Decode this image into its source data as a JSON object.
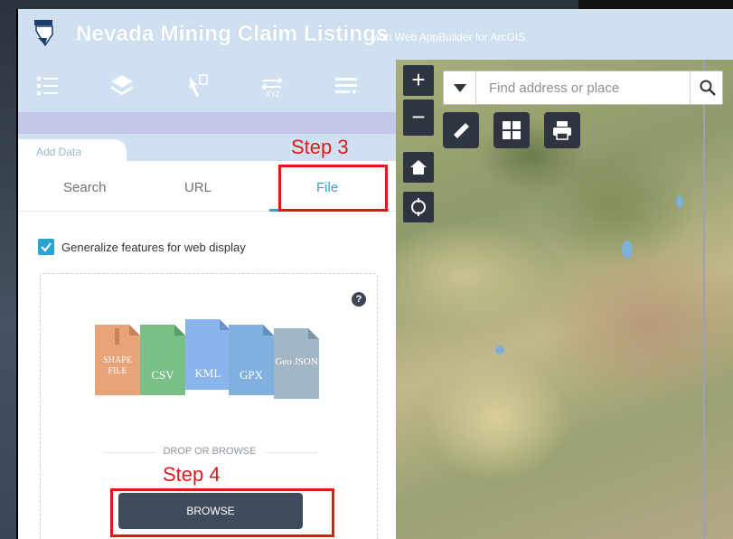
{
  "header": {
    "title": "Nevada Mining Claim Listings",
    "subtitle": "with Web AppBuilder for ArcGIS"
  },
  "toolbar": {
    "icons": [
      "legend-icon",
      "layers-icon",
      "measure-coordinates-icon",
      "xyz-coordinate-icon",
      "list-icon"
    ]
  },
  "panel": {
    "tab_label": "Add Data",
    "subtabs": [
      "Search",
      "URL",
      "File"
    ],
    "active_subtab": "File",
    "generalize_label": "Generalize features for web display",
    "generalize_checked": true,
    "file_types": [
      {
        "label": "SHAPE FILE",
        "color": "#e8a478"
      },
      {
        "label": "CSV",
        "color": "#7bbf88"
      },
      {
        "label": "KML",
        "color": "#8ab4ec"
      },
      {
        "label": "GPX",
        "color": "#7fb0df"
      },
      {
        "label": "Geo JSON",
        "color": "#a2b6c6"
      }
    ],
    "drop_text": "DROP OR BROWSE",
    "browse_label": "BROWSE",
    "help_glyph": "?"
  },
  "annotations": {
    "step3": "Step 3",
    "step4": "Step 4"
  },
  "map": {
    "search_placeholder": "Find address or place",
    "zoom_in": "+",
    "zoom_out": "−"
  },
  "colors": {
    "header_bg": "#cfe0f0",
    "accent": "#3aa0c8",
    "highlight": "#e01818",
    "button_dark": "#3f4b5b"
  }
}
